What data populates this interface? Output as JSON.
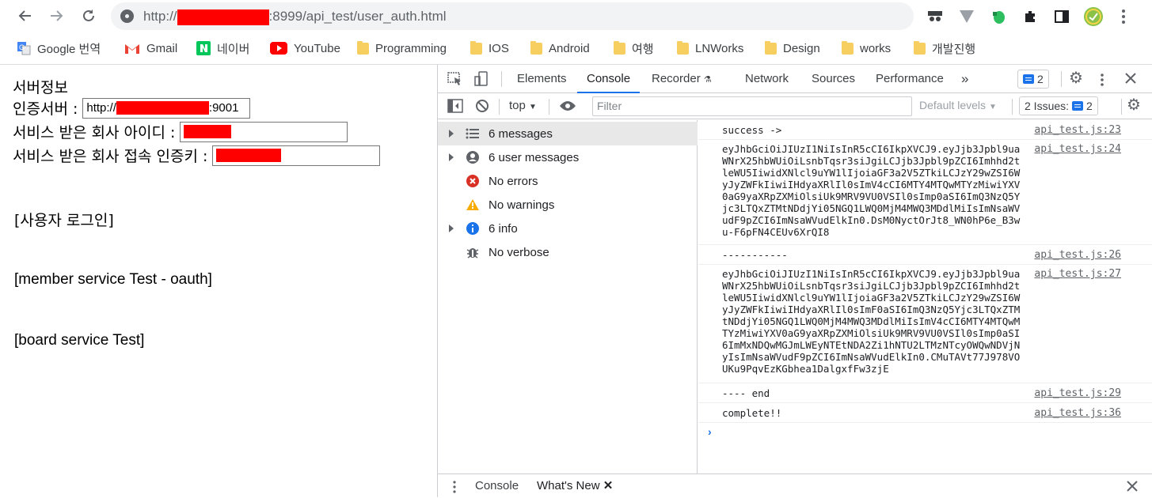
{
  "browser": {
    "url_prefix": "http://",
    "url_suffix": ":8999/api_test/user_auth.html"
  },
  "bookmarks": [
    {
      "label": "Google 번역",
      "icon": "google-translate-icon"
    },
    {
      "label": "Gmail",
      "icon": "gmail-icon"
    },
    {
      "label": "네이버",
      "icon": "naver-icon"
    },
    {
      "label": "YouTube",
      "icon": "youtube-icon"
    },
    {
      "label": "Programming",
      "icon": "folder-icon"
    },
    {
      "label": "IOS",
      "icon": "folder-icon"
    },
    {
      "label": "Android",
      "icon": "folder-icon"
    },
    {
      "label": "여행",
      "icon": "folder-icon"
    },
    {
      "label": "LNWorks",
      "icon": "folder-icon"
    },
    {
      "label": "Design",
      "icon": "folder-icon"
    },
    {
      "label": "works",
      "icon": "folder-icon"
    },
    {
      "label": "개발진행",
      "icon": "folder-icon"
    }
  ],
  "page": {
    "server_info": "서버정보",
    "auth_server_label": "인증서버 :",
    "auth_server_value_prefix": "http://",
    "auth_server_value_suffix": ":9001",
    "company_id_label": "서비스 받은 회사 아이디 :",
    "company_key_label": "서비스 받은 회사 접속 인증키 :",
    "section_login": "[사용자 로그인]",
    "section_member": "[member service Test - oauth]",
    "section_board": "[board service Test]"
  },
  "devtools": {
    "tabs": [
      "Elements",
      "Console",
      "Recorder",
      "Network",
      "Sources",
      "Performance"
    ],
    "active_tab": "Console",
    "more_tabs": "»",
    "message_badge": "2",
    "context": "top",
    "filter_placeholder": "Filter",
    "levels": "Default levels",
    "issues_label": "2 Issues:",
    "issues_count": "2",
    "sidebar": [
      {
        "label": "6 messages",
        "icon": "list-icon",
        "expandable": true,
        "selected": true
      },
      {
        "label": "6 user messages",
        "icon": "user-icon",
        "expandable": true,
        "selected": false
      },
      {
        "label": "No errors",
        "icon": "error-icon",
        "expandable": false,
        "selected": false
      },
      {
        "label": "No warnings",
        "icon": "warning-icon",
        "expandable": false,
        "selected": false
      },
      {
        "label": "6 info",
        "icon": "info-icon",
        "expandable": true,
        "selected": false
      },
      {
        "label": "No verbose",
        "icon": "bug-icon",
        "expandable": false,
        "selected": false
      }
    ],
    "messages": [
      {
        "text": "success ->",
        "source": "api_test.js:23"
      },
      {
        "text": "eyJhbGciOiJIUzI1NiIsInR5cCI6IkpXVCJ9.eyJjb3Jpbl9uaWNrX25hbWUiOiLsnbTqsr3siJgiLCJjb3Jpbl9pZCI6Imhhd2tleWU5IiwidXNlcl9uYW1lIjoiaGF3a2V5ZTkiLCJzY29wZSI6WyJyZWFkIiwiIHdyaXRlIl0sImV4cCI6MTY4MTQwMTYzMiwiYXV0aG9yaXRpZXMiOlsiUk9MRV9VU0VSIl0sImp0aSI6ImQ3NzQ5Yjc3LTQxZTMtNDdjYi05NGQ1LWQ0MjM4MWQ3MDdlMiIsImNsaWVudF9pZCI6ImNsaWVudElkIn0.DsM0NyctOrJt8_WN0hP6e_B3wu-F6pFN4CEUv6XrQI8",
        "source": "api_test.js:24"
      },
      {
        "text": "-----------",
        "source": "api_test.js:26"
      },
      {
        "text": "eyJhbGciOiJIUzI1NiIsInR5cCI6IkpXVCJ9.eyJjb3Jpbl9uaWNrX25hbWUiOiLsnbTqsr3siJgiLCJjb3Jpbl9pZCI6Imhhd2tleWU5IiwidXNlcl9uYW1lIjoiaGF3a2V5ZTkiLCJzY29wZSI6WyJyZWFkIiwiIHdyaXRlIl0sImF0aSI6ImQ3NzQ5Yjc3LTQxZTMtNDdjYi05NGQ1LWQ0MjM4MWQ3MDdlMiIsImV4cCI6MTY4MTQwMTYzMiwiYXV0aG9yaXRpZXMiOlsiUk9MRV9VU0VSIl0sImp0aSI6ImMxNDQwMGJmLWEyNTEtNDA2Zi1hNTU2LTMzNTcyOWQwNDVjNyIsImNsaWVudF9pZCI6ImNsaWVudElkIn0.CMuTAVt77J978VOUKu9PqvEzKGbhea1DalgxfFw3zjE",
        "source": "api_test.js:27"
      },
      {
        "text": "---- end",
        "source": "api_test.js:29"
      },
      {
        "text": "complete!!",
        "source": "api_test.js:36"
      }
    ],
    "prompt": "›",
    "drawer_tabs": [
      "Console",
      "What's New"
    ]
  }
}
